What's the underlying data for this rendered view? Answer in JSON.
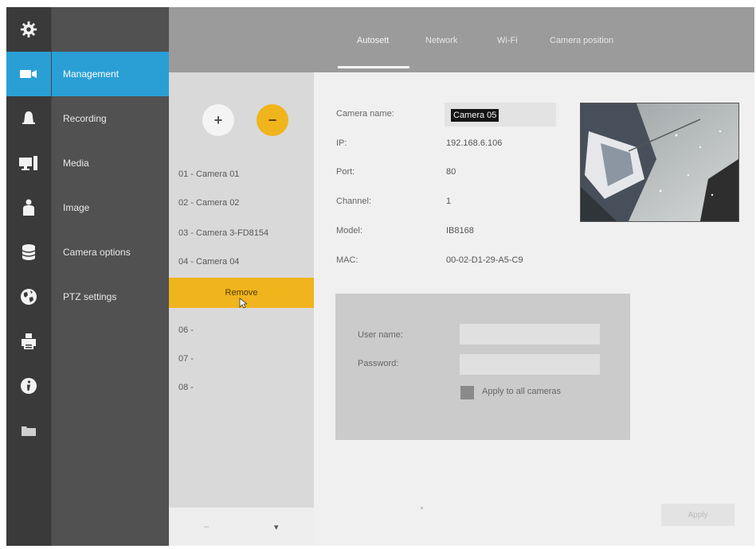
{
  "sidebar": {
    "icons": [
      {
        "icon": "gear-icon"
      },
      {
        "icon": "video-camera-icon",
        "active": true
      },
      {
        "icon": "alarm-bell-icon"
      },
      {
        "icon": "monitor-icon"
      },
      {
        "icon": "user-icon"
      },
      {
        "icon": "database-icon"
      },
      {
        "icon": "globe-icon"
      },
      {
        "icon": "printer-icon"
      },
      {
        "icon": "info-icon"
      },
      {
        "icon": "folder-icon"
      }
    ],
    "menu": [
      {
        "label": "Management",
        "active": true
      },
      {
        "label": "Recording"
      },
      {
        "label": "Media"
      },
      {
        "label": "Image"
      },
      {
        "label": "Camera options"
      },
      {
        "label": "PTZ settings"
      }
    ]
  },
  "tabs": [
    {
      "label": "Autosett",
      "active": true
    },
    {
      "label": "Network"
    },
    {
      "label": "Wi-Fi"
    },
    {
      "label": "Camera position"
    }
  ],
  "camera_list": {
    "add_label": "+",
    "remove_label": "−",
    "items": [
      "01 - Camera 01",
      "02 - Camera 02",
      "03 - Camera 3-FD8154",
      "04 - Camera 04"
    ],
    "remove_action": "Remove",
    "empty_slots": [
      "06 -",
      "07 -",
      "08 -"
    ],
    "footer_left": "–",
    "footer_right": "▾"
  },
  "details": {
    "camera_name_label": "Camera name:",
    "camera_name_value": "Camera 05",
    "ip_label": "IP:",
    "ip_value": "192.168.6.106",
    "port_label": "Port:",
    "port_value": "80",
    "channel_label": "Channel:",
    "channel_value": "1",
    "model_label": "Model:",
    "model_value": "IB8168",
    "mac_label": "MAC:",
    "mac_value": "00-02-D1-29-A5-C9"
  },
  "credentials": {
    "username_label": "User name:",
    "username_value": "",
    "password_label": "Password:",
    "password_value": "",
    "apply_all_label": "Apply to all cameras"
  },
  "apply_button": "Apply",
  "colors": {
    "accent_blue": "#2a9fd6",
    "accent_yellow": "#f0b41c",
    "sidebar_dark": "#3a3a3a"
  }
}
